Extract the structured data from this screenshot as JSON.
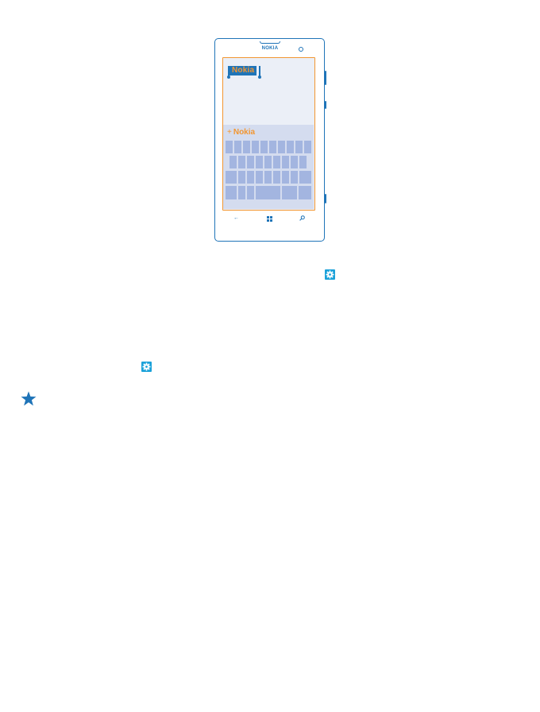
{
  "phone": {
    "brand": "NOKIA",
    "selected_word": "Nokia",
    "suggestion_word": "Nokia",
    "suggestion_prefix": "+",
    "nav_icons": [
      "back-arrow-icon",
      "windows-start-icon",
      "search-icon"
    ]
  },
  "icons": {
    "settings": "gear-icon",
    "tip": "star-icon"
  },
  "colors": {
    "phone_outline": "#1f74b8",
    "screen_border": "#f29631",
    "text_orange": "#f29631",
    "keyboard_bg": "#d4dcef",
    "key": "#a3b5e0",
    "settings_icon_bg": "#1aa1d9",
    "star": "#1f74b8"
  }
}
